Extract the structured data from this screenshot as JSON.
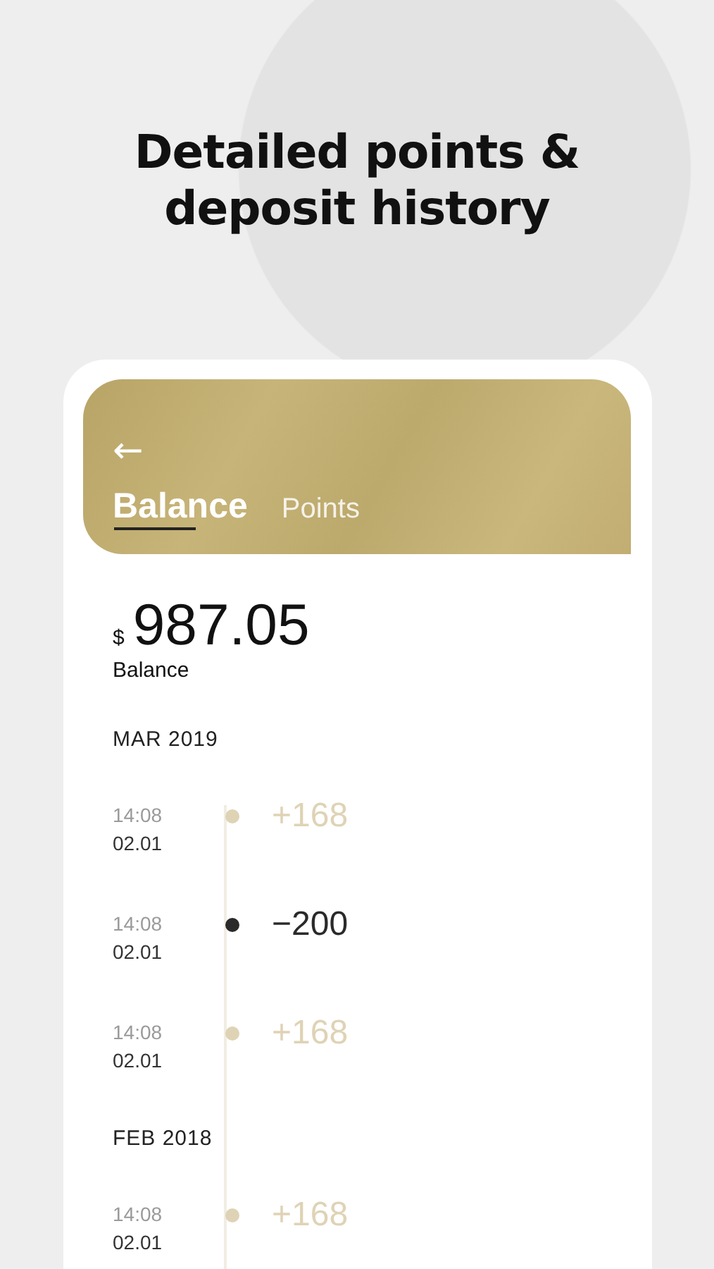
{
  "headline": "Detailed points & deposit history",
  "screen": {
    "back": "←",
    "tabs": [
      {
        "label": "Balance",
        "selected": true
      },
      {
        "label": "Points",
        "selected": false
      }
    ],
    "currency": "$",
    "amount": "987.05",
    "amount_label": "Balance",
    "groups": [
      {
        "month": "MAR 2019",
        "entries": [
          {
            "time": "14:08",
            "date": "02.01",
            "amount": "+168",
            "kind": "credit"
          },
          {
            "time": "14:08",
            "date": "02.01",
            "amount": "−200",
            "kind": "debit"
          },
          {
            "time": "14:08",
            "date": "02.01",
            "amount": "+168",
            "kind": "credit"
          }
        ]
      },
      {
        "month": "FEB 2018",
        "entries": [
          {
            "time": "14:08",
            "date": "02.01",
            "amount": "+168",
            "kind": "credit"
          }
        ]
      }
    ]
  }
}
